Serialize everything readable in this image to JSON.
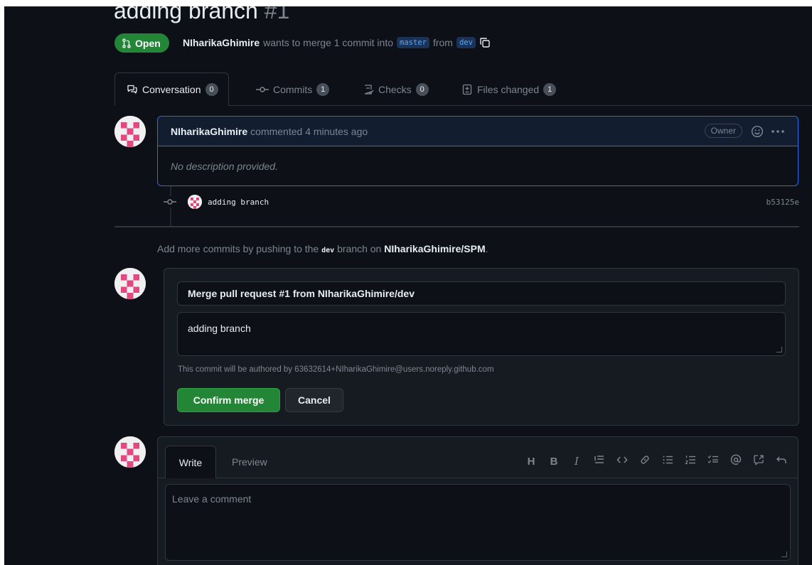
{
  "pr": {
    "title": "adding branch",
    "number": "#1",
    "state": "Open",
    "author": "NIharikaGhimire",
    "summary_mid": "wants to merge 1 commit into",
    "base_branch": "master",
    "from_word": "from",
    "head_branch": "dev"
  },
  "tabs": [
    {
      "label": "Conversation",
      "count": "0"
    },
    {
      "label": "Commits",
      "count": "1"
    },
    {
      "label": "Checks",
      "count": "0"
    },
    {
      "label": "Files changed",
      "count": "1"
    }
  ],
  "comment": {
    "author": "NIharikaGhimire",
    "meta": "commented 4 minutes ago",
    "role": "Owner",
    "body": "No description provided."
  },
  "commit": {
    "message": "adding branch",
    "sha": "b53125e"
  },
  "push_hint": {
    "pre": "Add more commits by pushing to the",
    "branch": "dev",
    "mid": "branch on",
    "repo": "NIharikaGhimire/SPM",
    "end": "."
  },
  "merge": {
    "title_value": "Merge pull request #1 from NIharikaGhimire/dev",
    "desc_value": "adding branch",
    "authored_note": "This commit will be authored by 63632614+NIharikaGhimire@users.noreply.github.com",
    "confirm_label": "Confirm merge",
    "cancel_label": "Cancel"
  },
  "write": {
    "tab_write": "Write",
    "tab_preview": "Preview",
    "placeholder": "Leave a comment",
    "toolbar": {
      "heading": "H",
      "bold": "B",
      "italic": "I"
    }
  },
  "colors": {
    "bg": "#0d1117",
    "open_green": "#238636",
    "accent_blue": "#1f6feb"
  }
}
